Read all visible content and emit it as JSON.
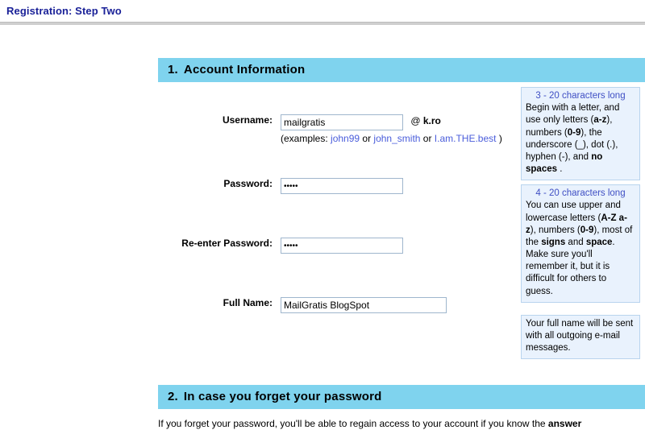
{
  "page": {
    "title": "Registration: Step Two"
  },
  "sections": [
    {
      "number": "1.",
      "heading": "Account Information"
    },
    {
      "number": "2.",
      "heading": "In case you forget your password",
      "body_prefix": "If you forget your password, you'll be able to regain access to your account if you know the ",
      "body_bold": "answer"
    }
  ],
  "fields": {
    "username": {
      "label": "Username:",
      "value": "mailgratis",
      "placeholder": "",
      "at_symbol": "@",
      "domain": "k.ro",
      "examples_prefix": "(examples: ",
      "example_1": "john99",
      "or_1": " or ",
      "example_2": "john_smith",
      "or_2": " or ",
      "example_3": "I.am.THE.best",
      "examples_suffix": " )"
    },
    "password": {
      "label": "Password:",
      "value": "•••••",
      "masked_value": "*****"
    },
    "password_confirm": {
      "label": "Re-enter Password:",
      "value": "•••••",
      "masked_value": "*****"
    },
    "full_name": {
      "label": "Full Name:",
      "value": "MailGratis BlogSpot",
      "placeholder": ""
    }
  },
  "help": {
    "username": {
      "headline": "3 - 20 characters long",
      "text_1": "Begin with a letter, and use only letters (",
      "bold_1": "a-z",
      "text_2": "), numbers (",
      "bold_2": "0-9",
      "text_3": "), the underscore (_), dot (.), hyphen (-), and ",
      "bold_3": "no spaces",
      "text_4": " ."
    },
    "password": {
      "headline": "4 - 20 characters long",
      "text_1": "You can use upper and lowercase letters (",
      "bold_1": "A-Z a-z",
      "text_2": "), numbers (",
      "bold_2": "0-9",
      "text_3": "), most of the ",
      "bold_3": "signs",
      "text_4": " and ",
      "bold_4": "space",
      "text_5": ". Make sure you'll remember it, but it is difficult for others to guess."
    },
    "full_name": {
      "text_1": "Your full name will be sent with all outgoing e-mail messages."
    }
  },
  "colors": {
    "title": "#1a2198",
    "section_header_bg": "#7fd3ee",
    "help_bg": "#e9f2fd",
    "help_border": "#b9d4ee",
    "help_headline": "#3f4fc4",
    "link": "#4a5ddb",
    "input_border": "#9fb6cd"
  }
}
